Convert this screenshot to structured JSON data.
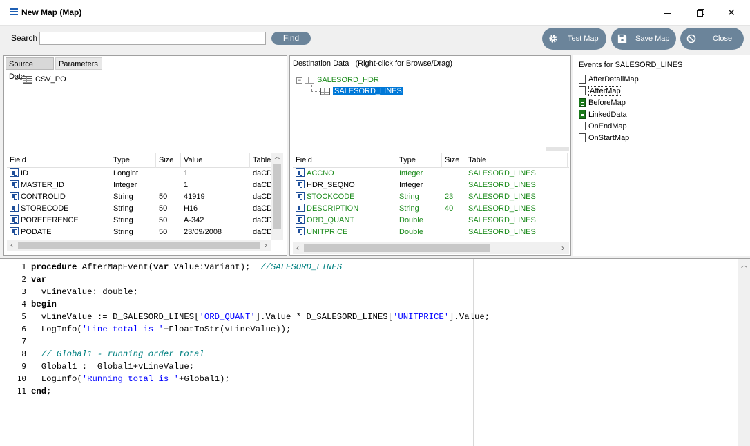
{
  "window": {
    "title": "New Map (Map)"
  },
  "toolbar": {
    "search_label": "Search",
    "search_value": "",
    "find_label": "Find",
    "test_map_label": "Test Map",
    "save_map_label": "Save Map",
    "close_label": "Close"
  },
  "source": {
    "tabs": [
      "Source Data",
      "Parameters"
    ],
    "tree_root": "CSV_PO",
    "columns": [
      "Field",
      "Type",
      "Size",
      "Value",
      "Table"
    ],
    "rows": [
      [
        "ID",
        "Longint",
        "",
        "1",
        "daCD"
      ],
      [
        "MASTER_ID",
        "Integer",
        "",
        "1",
        "daCD"
      ],
      [
        "CONTROLID",
        "String",
        "50",
        "41919",
        "daCD"
      ],
      [
        "STORECODE",
        "String",
        "50",
        "H16",
        "daCD"
      ],
      [
        "POREFERENCE",
        "String",
        "50",
        "A-342",
        "daCD"
      ],
      [
        "PODATE",
        "String",
        "50",
        "23/09/2008",
        "daCD"
      ]
    ]
  },
  "destination": {
    "header": "Destination Data",
    "hint": "(Right-click for Browse/Drag)",
    "tree_parent": "SALESORD_HDR",
    "tree_child": "SALESORD_LINES",
    "columns": [
      "Field",
      "Type",
      "Size",
      "Table"
    ],
    "rows": [
      [
        "ACCNO",
        "Integer",
        "",
        "SALESORD_LINES"
      ],
      [
        "HDR_SEQNO",
        "Integer",
        "",
        "SALESORD_LINES"
      ],
      [
        "STOCKCODE",
        "String",
        "23",
        "SALESORD_LINES"
      ],
      [
        "DESCRIPTION",
        "String",
        "40",
        "SALESORD_LINES"
      ],
      [
        "ORD_QUANT",
        "Double",
        "",
        "SALESORD_LINES"
      ],
      [
        "UNITPRICE",
        "Double",
        "",
        "SALESORD_LINES"
      ]
    ],
    "mapped": [
      true,
      false,
      true,
      true,
      true,
      true
    ],
    "mapped_color": "#1a8a1a"
  },
  "events": {
    "title": "Events for SALESORD_LINES",
    "items": [
      {
        "label": "AfterDetailMap",
        "has_code": false
      },
      {
        "label": "AfterMap",
        "has_code": false
      },
      {
        "label": "BeforeMap",
        "has_code": true
      },
      {
        "label": "LinkedData",
        "has_code": true
      },
      {
        "label": "OnEndMap",
        "has_code": false
      },
      {
        "label": "OnStartMap",
        "has_code": false
      }
    ]
  },
  "code": {
    "line_numbers": [
      "1",
      "2",
      "3",
      "4",
      "5",
      "6",
      "7",
      "8",
      "9",
      "10",
      "11"
    ],
    "l1_kw": "procedure",
    "l1_rest": " AfterMapEvent(",
    "l1_kw2": "var",
    "l1_rest2": " Value:Variant);  ",
    "l1_comment": "//SALESORD_LINES",
    "l2": "var",
    "l3": "  vLineValue: double;",
    "l4": "begin",
    "l5_a": "  vLineValue := D_SALESORD_LINES[",
    "l5_s1": "'ORD_QUANT'",
    "l5_b": "].Value * D_SALESORD_LINES[",
    "l5_s2": "'UNITPRICE'",
    "l5_c": "].Value;",
    "l6_a": "  LogInfo(",
    "l6_s": "'Line total is '",
    "l6_b": "+FloatToStr(vLineValue));",
    "l7": "",
    "l8": "  // Global1 - running order total",
    "l9": "  Global1 := Global1+vLineValue;",
    "l10_a": "  LogInfo(",
    "l10_s": "'Running total is '",
    "l10_b": "+Global1);",
    "l11_kw": "end",
    "l11_rest": ";"
  },
  "colors": {
    "accent_button": "#6b849a",
    "selection": "#0078d7",
    "string": "#0000ff",
    "comment": "#008080"
  }
}
